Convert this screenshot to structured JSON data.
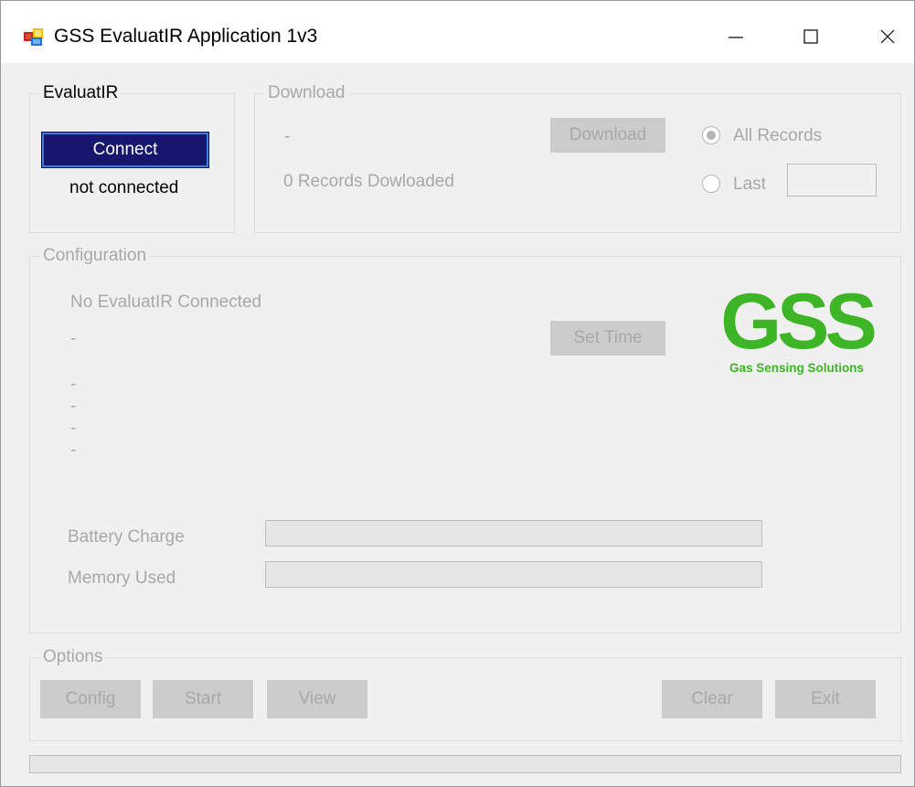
{
  "window": {
    "title": "GSS EvaluatIR Application 1v3",
    "icon": "application-icon",
    "controls": [
      "minimize-icon",
      "maximize-icon",
      "close-icon"
    ]
  },
  "evaluatir": {
    "legend": "EvaluatIR",
    "connect_label": "Connect",
    "status": "not connected"
  },
  "download": {
    "legend": "Download",
    "status_dash": "-",
    "records_text": "0 Records Dowloaded",
    "button_label": "Download",
    "option_all": "All Records",
    "option_last": "Last",
    "last_value": "",
    "selected_option": "All Records"
  },
  "configuration": {
    "legend": "Configuration",
    "device_status": "No EvaluatIR Connected",
    "line1": "-",
    "line2": "-",
    "line3": "-",
    "line4": "-",
    "line5": "-",
    "set_time_label": "Set Time",
    "battery_label": "Battery Charge",
    "battery_value": 0,
    "memory_label": "Memory Used",
    "memory_value": 0
  },
  "logo": {
    "main": "GSS",
    "sub": "Gas Sensing Solutions",
    "color": "#3db526"
  },
  "options": {
    "legend": "Options",
    "config_label": "Config",
    "start_label": "Start",
    "view_label": "View",
    "clear_label": "Clear",
    "exit_label": "Exit"
  },
  "status_progress": {
    "value": 0
  },
  "colors": {
    "connect_button": "#16166e",
    "connect_border": "#3a7de0",
    "disabled_text": "#a8a8a8",
    "window_bg": "#f0f0f0"
  }
}
